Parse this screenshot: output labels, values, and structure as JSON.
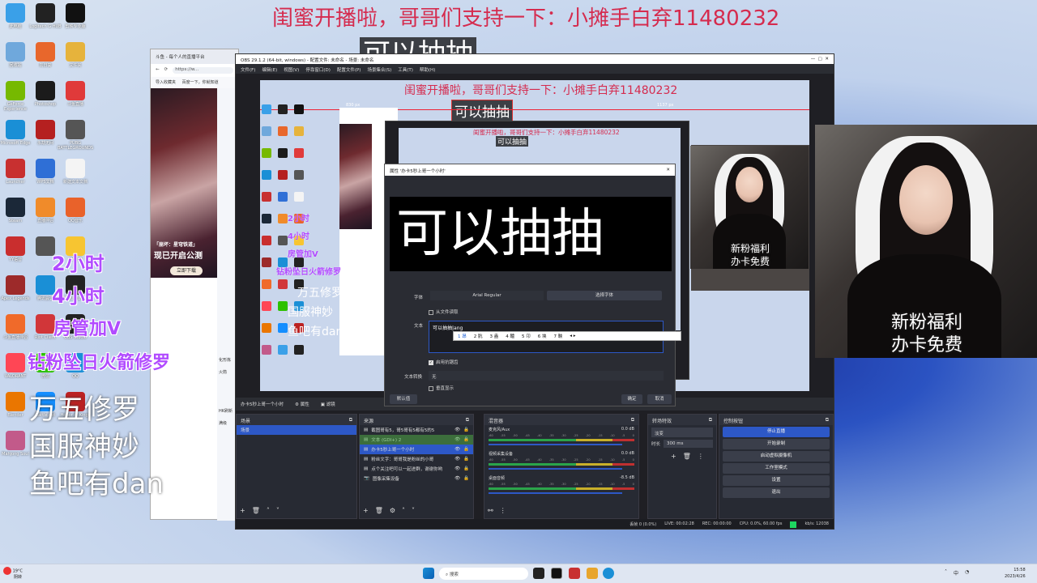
{
  "overlay": {
    "top_banner": "闺蜜开播啦，哥哥们支持一下：小摊手白弃11480232",
    "top_caption": "可以抽抽",
    "pink_lines": [
      "2小时",
      "4小时",
      "房管加V",
      "钻粉坠日火箭修罗"
    ],
    "white_lines": [
      "万五修罗",
      "国服神妙",
      "鱼吧有dan"
    ],
    "cam_small_caption": [
      "新粉福利",
      "办卡免费"
    ],
    "cam_large_caption": [
      "新粉福利",
      "办卡免费"
    ]
  },
  "desktop_icons": [
    {
      "label": "此电脑",
      "icon": "monitor-icon",
      "color": "#3aa0e8"
    },
    {
      "label": "Logitech G HUB",
      "icon": "logitech-icon",
      "color": "#222"
    },
    {
      "label": "剪映专业版",
      "icon": "capcut-icon",
      "color": "#111"
    },
    {
      "label": "回收站",
      "icon": "recycle-bin-icon",
      "color": "#6fa8dc"
    },
    {
      "label": "向日葵",
      "icon": "sunflower-icon",
      "color": "#e8672c"
    },
    {
      "label": "文件夹",
      "icon": "folder-icon",
      "color": "#e6b33c"
    },
    {
      "label": "GeForce Experience",
      "icon": "nvidia-icon",
      "color": "#76b900"
    },
    {
      "label": "Photoshop",
      "icon": "photoshop-icon",
      "color": "#1b1b1b"
    },
    {
      "label": "斗鱼直播",
      "icon": "douyu-icon",
      "color": "#e03a3a"
    },
    {
      "label": "Microsoft Edge",
      "icon": "edge-icon",
      "color": "#1a8fd6"
    },
    {
      "label": "永劫无间",
      "icon": "game-icon",
      "color": "#b52020"
    },
    {
      "label": "PUBG BATTLEGROUNDS",
      "icon": "pubg-icon",
      "color": "#555"
    },
    {
      "label": "Launcher",
      "icon": "launcher-icon",
      "color": "#c83030"
    },
    {
      "label": "WPS文档",
      "icon": "doc-icon",
      "color": "#2f6fd6"
    },
    {
      "label": "新建文本文档",
      "icon": "text-file-icon",
      "color": "#f4f4f4"
    },
    {
      "label": "Steam",
      "icon": "steam-icon",
      "color": "#1b2838"
    },
    {
      "label": "直播伴侣",
      "icon": "live-icon",
      "color": "#f08b2a"
    },
    {
      "label": "QQ音乐",
      "icon": "music-icon",
      "color": "#e9622a"
    },
    {
      "label": "YY语音",
      "icon": "yy-icon",
      "color": "#c92e2e"
    },
    {
      "label": "",
      "icon": "tool-icon",
      "color": "#555"
    },
    {
      "label": "YY直播",
      "icon": "yy-live-icon",
      "color": "#f7c531"
    },
    {
      "label": "Apex Legends",
      "icon": "apex-icon",
      "color": "#9d2a2a"
    },
    {
      "label": "腾讯会议",
      "icon": "meeting-icon",
      "color": "#1a8fd6"
    },
    {
      "label": "网易UU加速器",
      "icon": "uu-icon",
      "color": "#222"
    },
    {
      "label": "斗鱼直播伴侣",
      "icon": "douyu-live-icon",
      "color": "#f06a2a"
    },
    {
      "label": "Riot Client",
      "icon": "riot-icon",
      "color": "#d13639"
    },
    {
      "label": "OBS Studio",
      "icon": "obs-icon",
      "color": "#222"
    },
    {
      "label": "VALORANT",
      "icon": "valorant-icon",
      "color": "#ff4655"
    },
    {
      "label": "微信",
      "icon": "wechat-icon",
      "color": "#2dc100"
    },
    {
      "label": "QQ",
      "icon": "qq-icon",
      "color": "#1a8fd6"
    },
    {
      "label": "Blender",
      "icon": "blender-icon",
      "color": "#ea7600"
    },
    {
      "label": "Battle.net",
      "icon": "battlenet-icon",
      "color": "#148eff"
    },
    {
      "label": "Honor of Kings",
      "icon": "hok-icon",
      "color": "#b22"
    },
    {
      "label": "Mahjong Soul",
      "icon": "mahjong-icon",
      "color": "#c25a8a"
    }
  ],
  "browser": {
    "tab_title": "斗鱼 - 每个人的直播平台",
    "address": "https://w...",
    "bookmarks": [
      "导入收藏夹",
      "百度一下，你就知道"
    ],
    "banner_title": "「崩坏：星穹铁道」",
    "banner_slogan": "现已开启公测",
    "banner_button": "立即下载",
    "side_tags": [
      "化形炼",
      "火箭",
      "HK刷新",
      "满级"
    ]
  },
  "obs": {
    "title": "OBS 29.1.2 (64-bit, windows) - 配置文件: 未命名 - 场景: 未命名",
    "menu": [
      "文件(F)",
      "编辑(E)",
      "视图(V)",
      "停靠窗口(D)",
      "配置文件(P)",
      "场景集合(S)",
      "工具(T)",
      "帮助(H)"
    ],
    "preview_banner": "闺蜜开播啦，哥哥们支持一下：小摊手白弃11480232",
    "preview_caption": "可以抽抽",
    "preview_w": "830 px",
    "preview_h": "1137 px",
    "nested_banner": "闺蜜开播啦，哥哥们支持一下：小摊手白弃11480232",
    "nested_caption": "可以抽抽",
    "source_bar": {
      "label": "办卡5秒上哥一个小时",
      "props": "属性",
      "filters": "滤镜"
    },
    "scenes": {
      "title": "场景",
      "items": [
        "场景"
      ]
    },
    "sources": {
      "title": "来源",
      "items": [
        "截图哥有5，哥5哥有5都有5的5",
        "文本 (GDI+) 2",
        "办卡5秒上哥一个小时",
        "粉丝文字：哥哥我是粉丝的小哥",
        "点个关注吧可以一起进群，谢谢你哟",
        "图像采集设备"
      ]
    },
    "mixer": {
      "title": "混音器",
      "channels": [
        {
          "name": "麦克风/Aux",
          "db": "0.0 dB"
        },
        {
          "name": "视频采集设备",
          "db": "0.0 dB"
        },
        {
          "name": "桌面音频",
          "db": "-8.5 dB"
        }
      ],
      "scale": [
        "-60",
        "-55",
        "-50",
        "-45",
        "-40",
        "-35",
        "-30",
        "-25",
        "-20",
        "-15",
        "-10",
        "-5",
        "0"
      ]
    },
    "transitions": {
      "title": "转场特效",
      "type": "淡变",
      "duration_label": "时长",
      "duration": "300 ms"
    },
    "controls": {
      "title": "控制按钮",
      "buttons": [
        "停止直播",
        "开始录制",
        "启动虚拟摄像机",
        "工作室模式",
        "设置",
        "退出"
      ]
    },
    "status": {
      "dropped": "丢帧 0 (0.0%)",
      "live": "LIVE: 00:02:28",
      "rec": "REC: 00:00:00",
      "cpu": "CPU: 0.0%, 60.00 fps",
      "kbps": "kb/s: 12038"
    }
  },
  "dialog": {
    "title": "属性 '办卡5秒上哥一个小时'",
    "preview_text": "可以抽抽",
    "font_label": "字体",
    "font_value": "Arial Regular",
    "font_button": "选择字体",
    "from_file_label": "从文件读取",
    "text_label": "文本",
    "text_value": "可以抽抽|ang",
    "ime_candidates": [
      "1 昂",
      "2 肮",
      "3 盎",
      "4 醠",
      "5 卬",
      "6 坱",
      "7 軮"
    ],
    "antialias_label": "启用抗锯齿",
    "transform_label": "文本转换",
    "transform_value": "无",
    "vertical_label": "垂直显示",
    "defaults_button": "默认值",
    "ok_button": "确定",
    "cancel_button": "取消"
  },
  "taskbar": {
    "weather_temp": "19°C",
    "weather_desc": "阴转",
    "search_placeholder": "搜索",
    "time": "15:58",
    "date": "2023/4/26",
    "lang": "中"
  }
}
